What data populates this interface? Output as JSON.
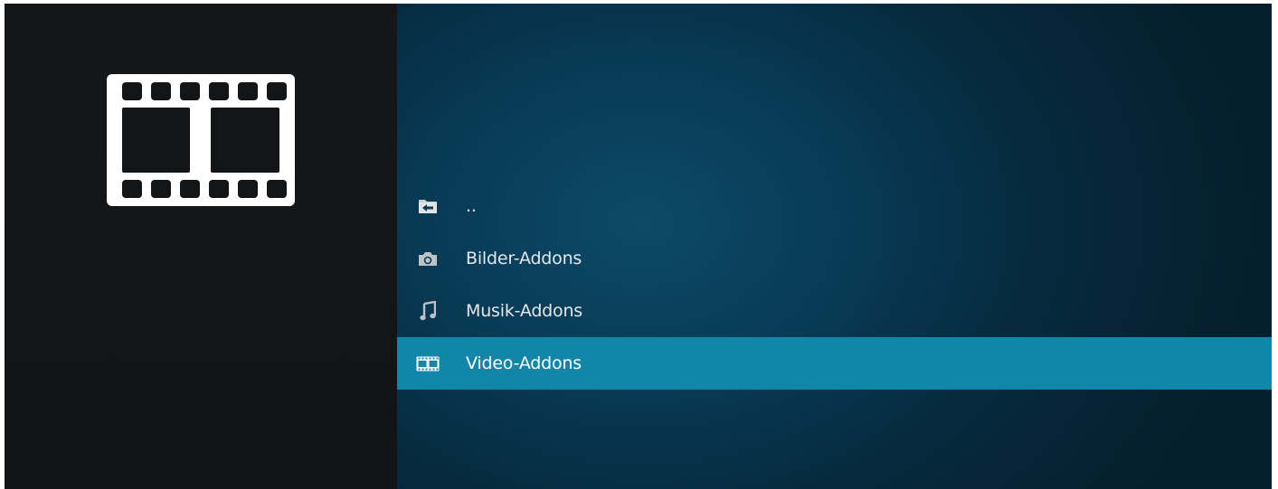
{
  "window": {
    "section_icon": "film-strip-icon"
  },
  "list": {
    "items": [
      {
        "label": "..",
        "icon": "folder-back-icon",
        "selected": false
      },
      {
        "label": "Bilder-Addons",
        "icon": "camera-icon",
        "selected": false
      },
      {
        "label": "Musik-Addons",
        "icon": "music-note-icon",
        "selected": false
      },
      {
        "label": "Video-Addons",
        "icon": "film-icon",
        "selected": true
      }
    ]
  },
  "colors": {
    "selection": "#1186a8",
    "left_panel": "#131517",
    "right_panel": "#083a55",
    "text": "#e4e8ea"
  }
}
